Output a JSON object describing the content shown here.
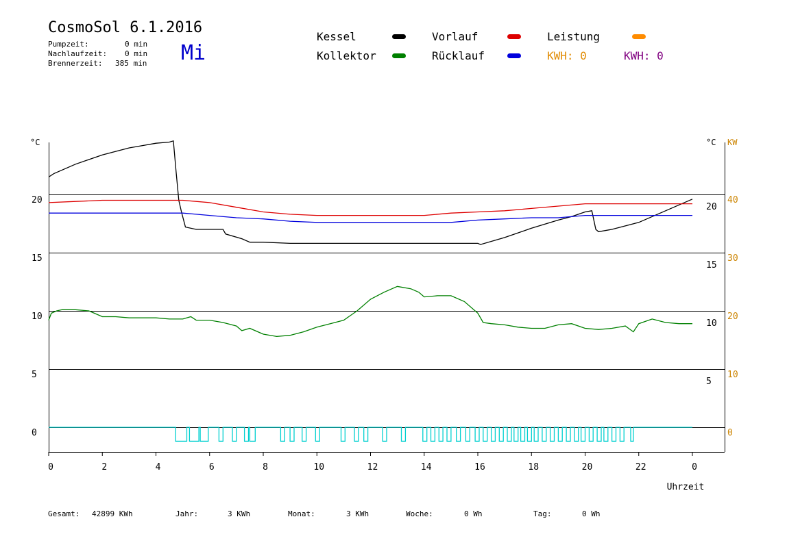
{
  "header": {
    "title": "CosmoSol 6.1.2016",
    "day": "Mi",
    "pumpzeit_label": "Pumpzeit:",
    "pumpzeit_value": "0 min",
    "nachlaufzeit_label": "Nachlaufzeit:",
    "nachlaufzeit_value": "0 min",
    "brennerzeit_label": "Brennerzeit:",
    "brennerzeit_value": "385 min"
  },
  "legend": {
    "kessel": "Kessel",
    "kollektor": "Kollektor",
    "vorlauf": "Vorlauf",
    "ruecklauf": "Rücklauf",
    "leistung": "Leistung",
    "kwh1": "KWH: 0",
    "kwh2": "KWH: 0"
  },
  "colors": {
    "kessel": "#000000",
    "kollektor": "#008000",
    "vorlauf": "#dd0000",
    "ruecklauf": "#0000dd",
    "leistung": "#ff8c00",
    "kwh2": "#800080",
    "pump": "#00d0d0",
    "kw_axis": "#cc8400"
  },
  "footer": {
    "gesamt_label": "Gesamt:",
    "gesamt_value": "42899 KWh",
    "jahr_label": "Jahr:",
    "jahr_value": "3 KWh",
    "monat_label": "Monat:",
    "monat_value": "3 KWh",
    "woche_label": "Woche:",
    "woche_value": "0 Wh",
    "tag_label": "Tag:",
    "tag_value": "0 Wh"
  },
  "chart_data": {
    "type": "line",
    "xlabel": "Uhrzeit",
    "left_unit": "°C",
    "right_unit": "°C",
    "right_unit2": "KW",
    "xlim": [
      0,
      24
    ],
    "ylim": [
      -1.5,
      24.5
    ],
    "x_ticks": [
      0,
      2,
      4,
      6,
      8,
      10,
      12,
      14,
      16,
      18,
      20,
      22,
      24
    ],
    "x_tick_labels": [
      "0",
      "2",
      "4",
      "6",
      "8",
      "10",
      "12",
      "14",
      "16",
      "18",
      "20",
      "22",
      "0"
    ],
    "left_ticks": [
      0,
      5,
      10,
      15,
      20
    ],
    "right_ticks": [
      5,
      10,
      15,
      20
    ],
    "kw_ticks": [
      0,
      10,
      20,
      30,
      40
    ],
    "gridlines": [
      0,
      5,
      10,
      15,
      20
    ],
    "series": [
      {
        "name": "Kessel",
        "x": [
          0,
          0.2,
          0.5,
          1,
          1.5,
          2,
          2.5,
          3,
          3.5,
          4,
          4.5,
          4.65,
          4.75,
          4.85,
          4.95,
          5.1,
          5.5,
          6.5,
          6.6,
          7.2,
          7.5,
          8,
          9,
          10,
          11,
          12,
          13,
          14,
          15,
          16,
          16.1,
          17,
          18,
          19,
          19.5,
          20,
          20.25,
          20.4,
          20.5,
          21,
          22,
          23,
          24
        ],
        "y": [
          21.5,
          21.8,
          22.1,
          22.6,
          23.0,
          23.4,
          23.7,
          24.0,
          24.2,
          24.4,
          24.5,
          24.6,
          22.0,
          19.5,
          18.5,
          17.2,
          17.0,
          17.0,
          16.6,
          16.2,
          15.9,
          15.9,
          15.8,
          15.8,
          15.8,
          15.8,
          15.8,
          15.8,
          15.8,
          15.8,
          15.7,
          16.3,
          17.1,
          17.8,
          18.1,
          18.5,
          18.6,
          17.0,
          16.8,
          17.0,
          17.6,
          18.6,
          19.6
        ]
      },
      {
        "name": "Vorlauf",
        "x": [
          0,
          1,
          2,
          3,
          4,
          4.7,
          5,
          5.5,
          6,
          7,
          8,
          9,
          10,
          11,
          12,
          13,
          14,
          15,
          16,
          17,
          18,
          19,
          20,
          21,
          22,
          23,
          24
        ],
        "y": [
          19.3,
          19.4,
          19.5,
          19.5,
          19.5,
          19.5,
          19.5,
          19.4,
          19.3,
          18.9,
          18.5,
          18.3,
          18.2,
          18.2,
          18.2,
          18.2,
          18.2,
          18.4,
          18.5,
          18.6,
          18.8,
          19.0,
          19.2,
          19.2,
          19.2,
          19.2,
          19.2
        ]
      },
      {
        "name": "Rücklauf",
        "x": [
          0,
          1,
          2,
          3,
          4,
          5,
          5.5,
          6,
          7,
          8,
          9,
          10,
          11,
          12,
          13,
          14,
          15,
          16,
          17,
          18,
          19,
          20,
          21,
          22,
          23,
          24
        ],
        "y": [
          18.4,
          18.4,
          18.4,
          18.4,
          18.4,
          18.4,
          18.3,
          18.2,
          18.0,
          17.9,
          17.7,
          17.6,
          17.6,
          17.6,
          17.6,
          17.6,
          17.6,
          17.8,
          17.9,
          18.0,
          18.0,
          18.2,
          18.2,
          18.2,
          18.2,
          18.2
        ]
      },
      {
        "name": "Kollektor",
        "x": [
          0,
          0.1,
          0.3,
          0.5,
          1,
          1.5,
          1.7,
          2,
          2.5,
          3,
          3.5,
          4,
          4.5,
          5,
          5.3,
          5.5,
          6,
          6.5,
          7,
          7.2,
          7.5,
          8,
          8.5,
          9,
          9.5,
          10,
          10.5,
          11,
          11.5,
          12,
          12.5,
          13,
          13.5,
          13.8,
          14,
          14.5,
          15,
          15.5,
          16,
          16.2,
          16.5,
          17,
          17.5,
          18,
          18.5,
          19,
          19.5,
          20,
          20.5,
          21,
          21.5,
          21.8,
          22,
          22.5,
          23,
          23.5,
          24
        ],
        "y": [
          9.2,
          9.8,
          10.0,
          10.1,
          10.1,
          10.0,
          9.8,
          9.5,
          9.5,
          9.4,
          9.4,
          9.4,
          9.3,
          9.3,
          9.5,
          9.2,
          9.2,
          9.0,
          8.7,
          8.3,
          8.5,
          8.0,
          7.8,
          7.9,
          8.2,
          8.6,
          8.9,
          9.2,
          10.0,
          11.0,
          11.6,
          12.1,
          11.9,
          11.6,
          11.2,
          11.3,
          11.3,
          10.8,
          9.8,
          9.0,
          8.9,
          8.8,
          8.6,
          8.5,
          8.5,
          8.8,
          8.9,
          8.5,
          8.4,
          8.5,
          8.7,
          8.2,
          8.9,
          9.3,
          9.0,
          8.9,
          8.9
        ]
      }
    ],
    "pump_on_intervals": [
      [
        4.73,
        5.15
      ],
      [
        5.25,
        5.6
      ],
      [
        5.65,
        5.95
      ],
      [
        6.35,
        6.5
      ],
      [
        6.85,
        7.0
      ],
      [
        7.3,
        7.45
      ],
      [
        7.5,
        7.7
      ],
      [
        8.65,
        8.8
      ],
      [
        9.0,
        9.15
      ],
      [
        9.45,
        9.6
      ],
      [
        9.95,
        10.1
      ],
      [
        10.9,
        11.05
      ],
      [
        11.4,
        11.55
      ],
      [
        11.75,
        11.9
      ],
      [
        12.45,
        12.6
      ],
      [
        13.15,
        13.3
      ],
      [
        13.95,
        14.1
      ],
      [
        14.25,
        14.4
      ],
      [
        14.55,
        14.7
      ],
      [
        14.85,
        15.0
      ],
      [
        15.2,
        15.35
      ],
      [
        15.55,
        15.7
      ],
      [
        15.9,
        16.05
      ],
      [
        16.2,
        16.35
      ],
      [
        16.5,
        16.65
      ],
      [
        16.8,
        16.95
      ],
      [
        17.1,
        17.25
      ],
      [
        17.35,
        17.5
      ],
      [
        17.6,
        17.75
      ],
      [
        17.85,
        18.0
      ],
      [
        18.1,
        18.25
      ],
      [
        18.4,
        18.55
      ],
      [
        18.7,
        18.85
      ],
      [
        19.0,
        19.15
      ],
      [
        19.3,
        19.45
      ],
      [
        19.6,
        19.75
      ],
      [
        19.85,
        20.0
      ],
      [
        20.15,
        20.3
      ],
      [
        20.45,
        20.6
      ],
      [
        20.7,
        20.85
      ],
      [
        21.0,
        21.15
      ],
      [
        21.3,
        21.45
      ],
      [
        21.7,
        21.8
      ]
    ]
  }
}
